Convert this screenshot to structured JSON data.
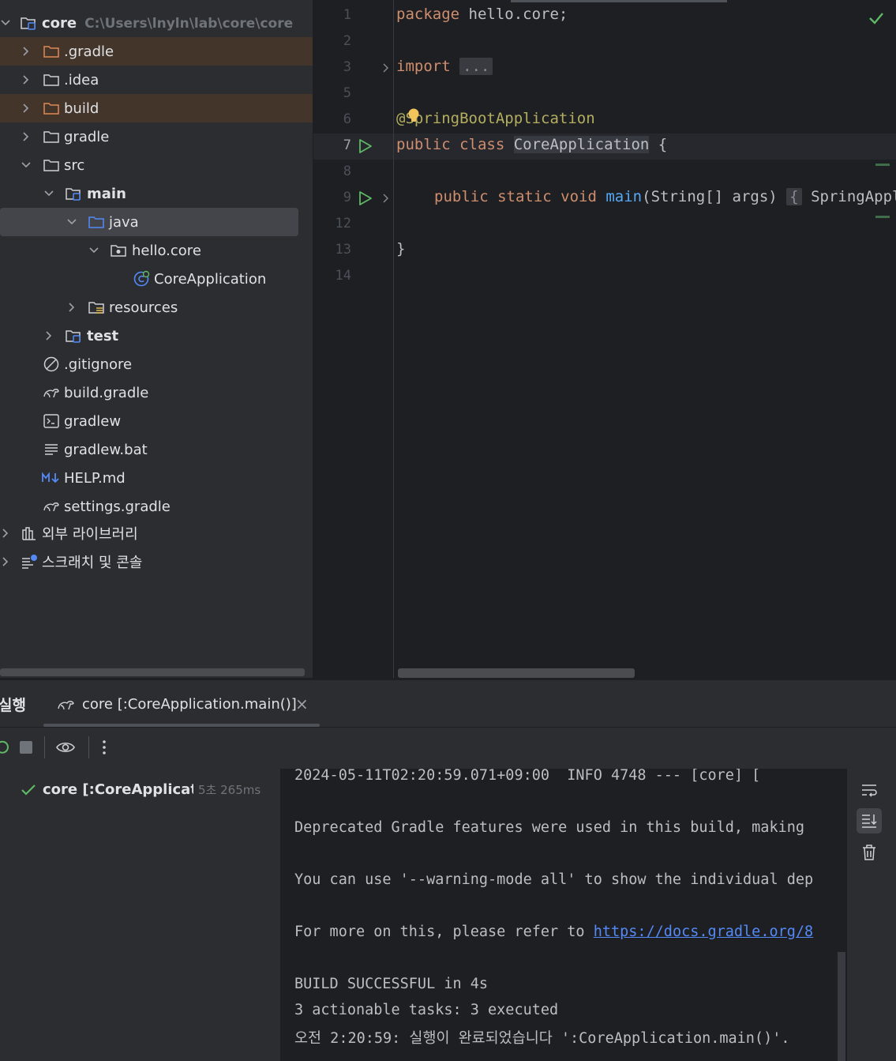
{
  "project_tree": {
    "root": {
      "label": "core",
      "path": "C:\\Users\\lnyln\\lab\\core\\core"
    },
    "items": [
      {
        "label": ".gradle"
      },
      {
        "label": ".idea"
      },
      {
        "label": "build"
      },
      {
        "label": "gradle"
      },
      {
        "label": "src"
      },
      {
        "label": "main"
      },
      {
        "label": "java"
      },
      {
        "label": "hello.core"
      },
      {
        "label": "CoreApplication"
      },
      {
        "label": "resources"
      },
      {
        "label": "test"
      },
      {
        "label": ".gitignore"
      },
      {
        "label": "build.gradle"
      },
      {
        "label": "gradlew"
      },
      {
        "label": "gradlew.bat"
      },
      {
        "label": "HELP.md"
      },
      {
        "label": "settings.gradle"
      },
      {
        "label": "외부 라이브러리"
      },
      {
        "label": "스크래치 및 콘솔"
      }
    ]
  },
  "editor": {
    "line_numbers": [
      "1",
      "2",
      "3",
      "5",
      "6",
      "7",
      "8",
      "9",
      "12",
      "13",
      "14"
    ],
    "code": {
      "l1_kw": "package",
      "l1_rest": " hello.core;",
      "l3_kw": "import",
      "l3_fold": "...",
      "l6_ann": "@SpringBootApplication",
      "l7_kw": "public class",
      "l7_class": "CoreApplication",
      "l7_rest": " {",
      "l9_kw": "public static void",
      "l9_fn": "main",
      "l9_rest": "(String[] args)",
      "l9_fold": "{",
      "l9_tail": "SpringApplication",
      "l13": "}"
    }
  },
  "run_panel": {
    "title": "실행",
    "tab_label": "core [:CoreApplication.main()]",
    "close_glyph": "×",
    "tree_item": {
      "label": "core [:CoreApplication.main()]",
      "time": "5초 265ms"
    },
    "console_lines": {
      "l1": "2024-05-11T02:20:59.071+09:00  INFO 4748 --- [core] [",
      "l2": "Deprecated Gradle features were used in this build, making",
      "l3": "You can use '--warning-mode all' to show the individual dep",
      "l4_text": "For more on this, please refer to ",
      "l4_link": "https://docs.gradle.org/8",
      "l5": "BUILD SUCCESSFUL in 4s",
      "l6": "3 actionable tasks: 3 executed",
      "l7": "오전 2:20:59: 실행이 완료되었습니다 ':CoreApplication.main()'."
    }
  },
  "colors": {
    "excluded_folder": "#e08855",
    "source_folder": "#548af7",
    "run_green": "#5fb865"
  }
}
